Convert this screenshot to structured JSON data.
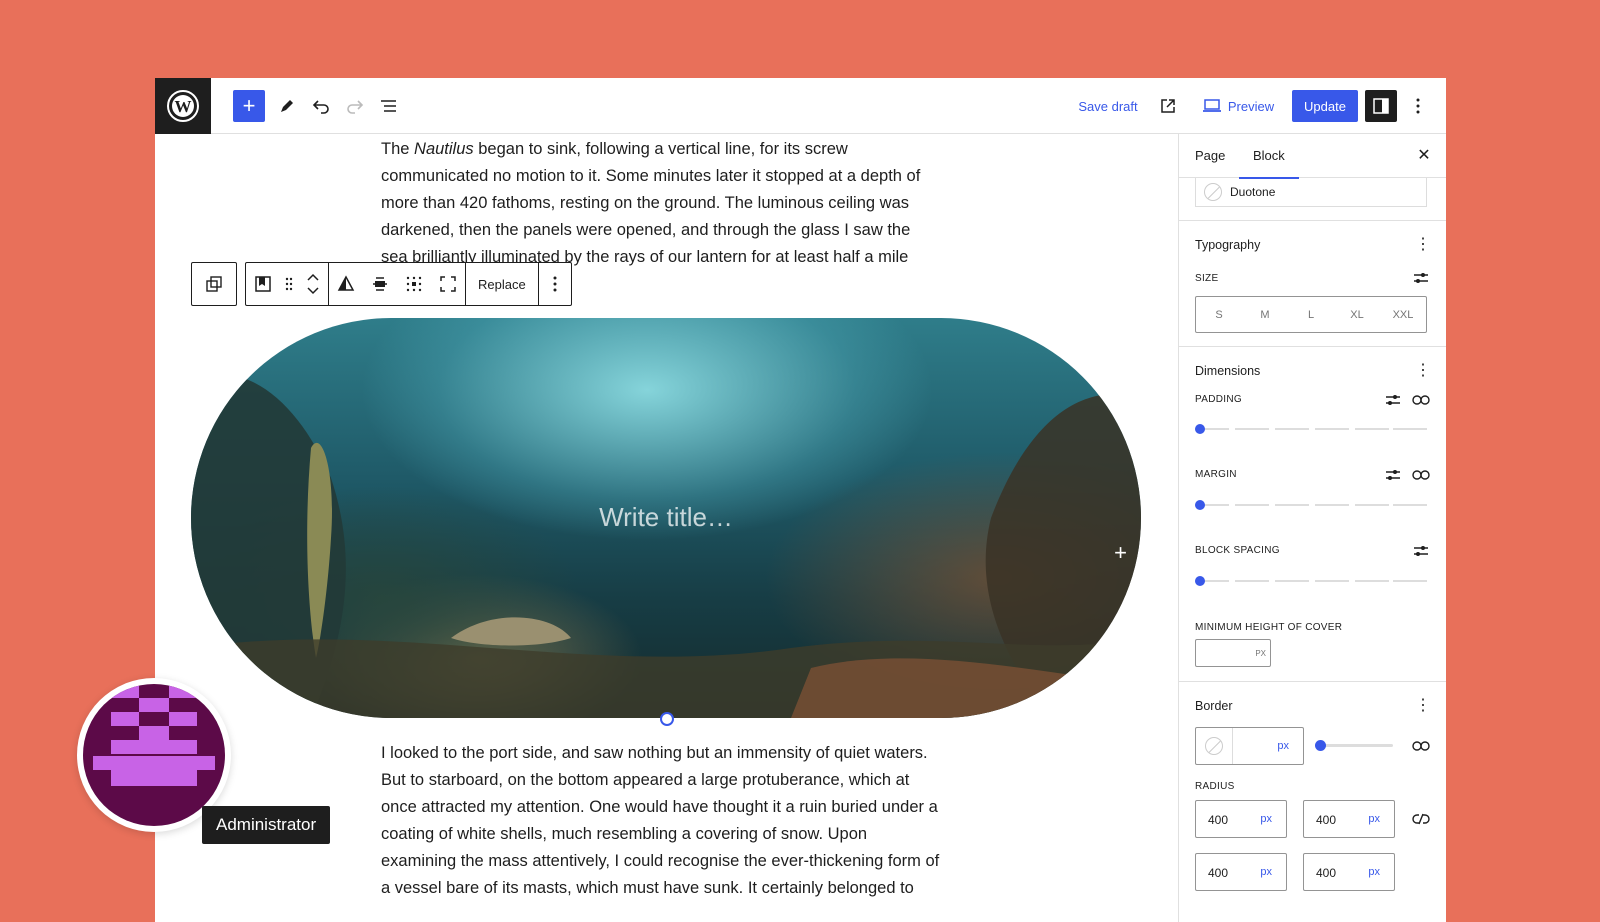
{
  "topbar": {
    "save_draft": "Save draft",
    "preview": "Preview",
    "update": "Update"
  },
  "editor": {
    "para1_pre": "The ",
    "para1_em": "Nautilus",
    "para1_post": " began to sink, following a vertical line, for its screw communicated no motion to it. Some minutes later it stopped at a depth of more than 420 fathoms, resting on the ground. The luminous ceiling was darkened, then the panels were opened, and through the glass I saw the sea brilliantly illuminated by the rays of our lantern for at least half a mile",
    "block_toolbar": {
      "replace": "Replace"
    },
    "cover_title_placeholder": "Write title…",
    "para2": "I looked to the port side, and saw nothing but an immensity of quiet waters. But to starboard, on the bottom appeared a large protuberance, which at once attracted my attention. One would have thought it a ruin buried under a coating of white shells, much resembling a covering of snow. Upon examining the mass attentively, I could recognise the ever-thickening form of a vessel bare of its masts, which must have sunk. It certainly belonged to"
  },
  "sidebar": {
    "tabs": [
      "Page",
      "Block"
    ],
    "duotone_label": "Duotone",
    "typography": {
      "title": "Typography",
      "size_label": "SIZE",
      "sizes": [
        "S",
        "M",
        "L",
        "XL",
        "XXL"
      ]
    },
    "dimensions": {
      "title": "Dimensions",
      "padding_label": "PADDING",
      "margin_label": "MARGIN",
      "block_spacing_label": "BLOCK SPACING",
      "min_height_label": "MINIMUM HEIGHT OF COVER",
      "min_height_unit": "PX",
      "padding_value": 0,
      "margin_value": 0,
      "block_spacing_value": 0
    },
    "border": {
      "title": "Border",
      "width_unit": "px",
      "radius_label": "RADIUS",
      "radius": [
        {
          "value": "400",
          "unit": "px"
        },
        {
          "value": "400",
          "unit": "px"
        },
        {
          "value": "400",
          "unit": "px"
        },
        {
          "value": "400",
          "unit": "px"
        }
      ]
    }
  },
  "user": {
    "tooltip": "Administrator"
  },
  "colors": {
    "accent": "#3858e9",
    "background": "#e8705a",
    "dark": "#1e1e1e"
  }
}
